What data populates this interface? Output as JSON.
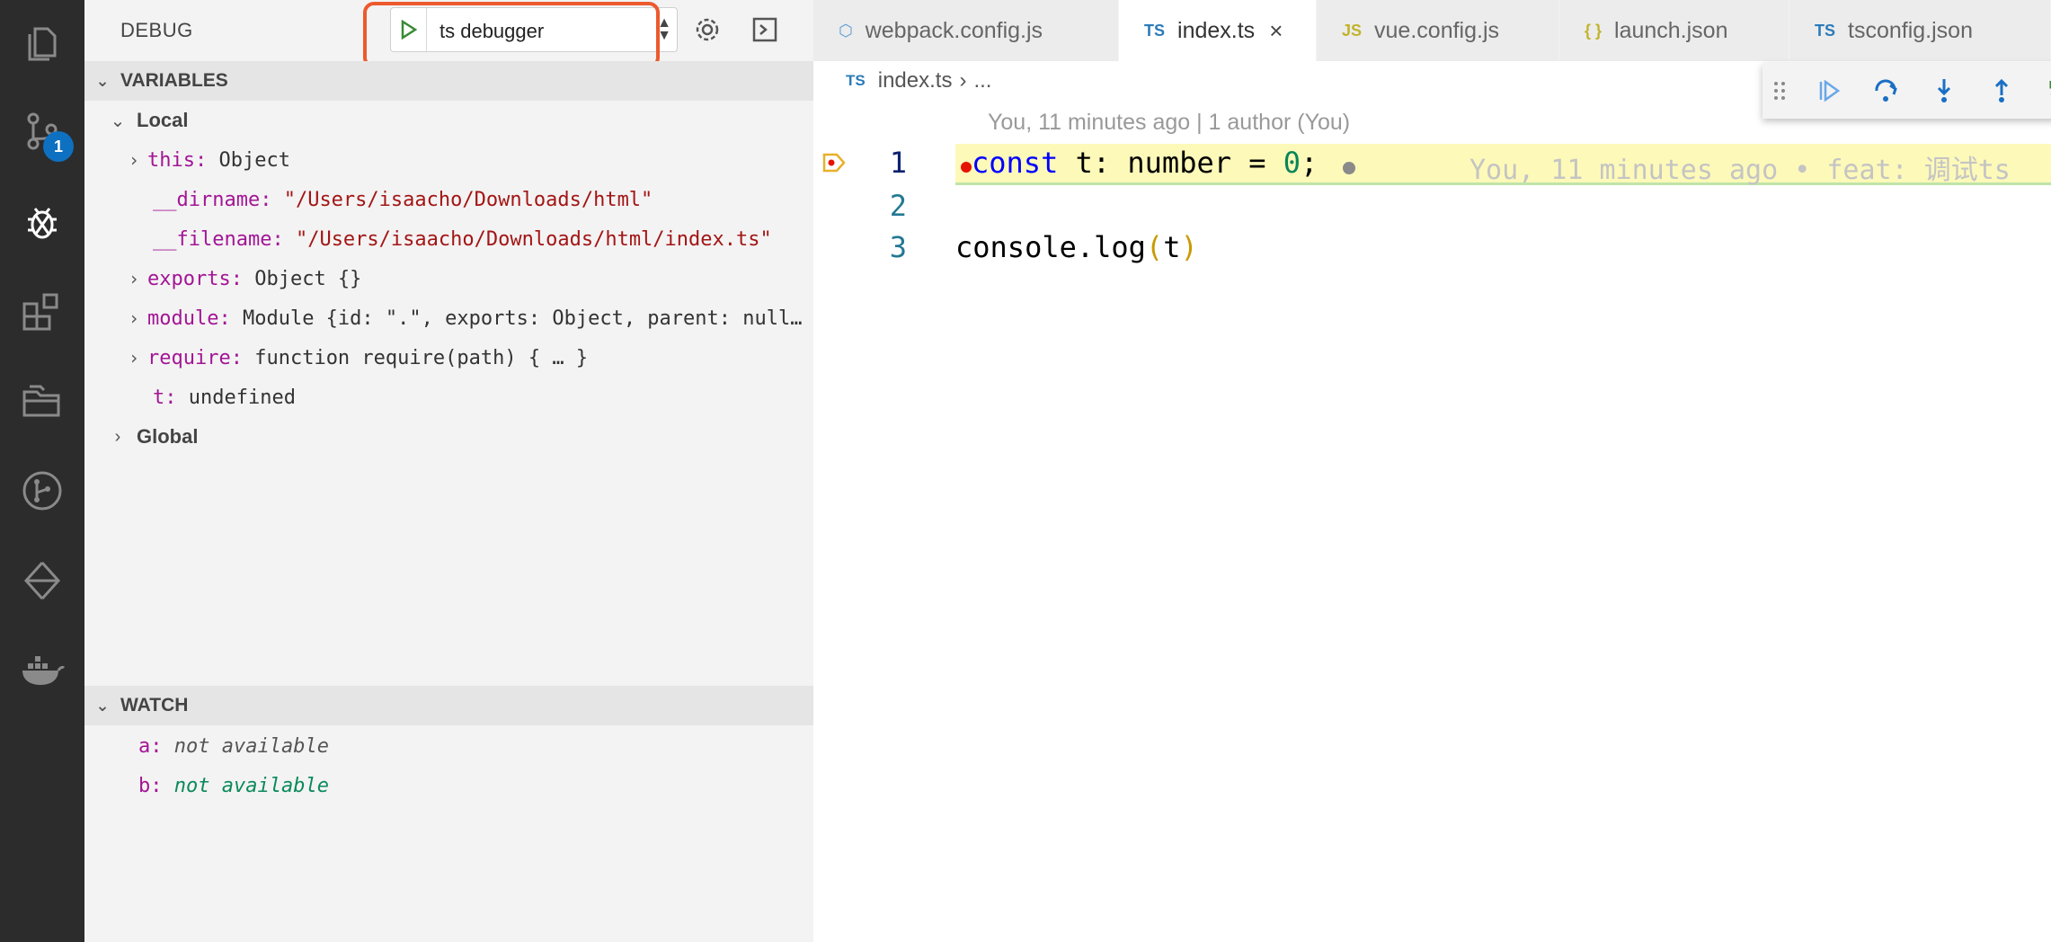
{
  "activity_bar": {
    "items": [
      {
        "name": "explorer-icon"
      },
      {
        "name": "source-control-icon",
        "badge": "1"
      },
      {
        "name": "debug-icon"
      },
      {
        "name": "extensions-icon"
      },
      {
        "name": "folders-icon"
      },
      {
        "name": "git-graph-icon"
      },
      {
        "name": "remote-icon"
      },
      {
        "name": "docker-icon"
      }
    ]
  },
  "sidebar": {
    "title": "DEBUG",
    "launch_config": "ts debugger",
    "variables_header": "VARIABLES",
    "local_scope": "Local",
    "global_scope": "Global",
    "variables": [
      {
        "name": "this:",
        "value": "Object"
      },
      {
        "name": "__dirname:",
        "value": "\"/Users/isaacho/Downloads/html\""
      },
      {
        "name": "__filename:",
        "value": "\"/Users/isaacho/Downloads/html/index.ts\""
      },
      {
        "name": "exports:",
        "value": "Object {}"
      },
      {
        "name": "module:",
        "value": "Module {id: \".\", exports: Object, parent: null…"
      },
      {
        "name": "require:",
        "value": "function require(path) { … }"
      },
      {
        "name": "t:",
        "value": "undefined"
      }
    ],
    "watch_header": "WATCH",
    "watch": [
      {
        "name": "a:",
        "value": "not available"
      },
      {
        "name": "b:",
        "value": "not available"
      }
    ]
  },
  "tabs": [
    {
      "icon": "⬡",
      "label": "webpack.config.js"
    },
    {
      "icon": "TS",
      "label": "index.ts",
      "close": "×"
    },
    {
      "icon": "JS",
      "label": "vue.config.js"
    },
    {
      "icon": "{ }",
      "label": "launch.json"
    },
    {
      "icon": "TS",
      "label": "tsconfig.json"
    }
  ],
  "breadcrumb": {
    "icon": "TS",
    "file": "index.ts",
    "sep": "›",
    "rest": "..."
  },
  "editor": {
    "blame": "You, 11 minutes ago | 1 author (You)",
    "line_numbers": [
      "1",
      "2",
      "3"
    ],
    "line1": {
      "kw": "const",
      "rest": " t: number = ",
      "num": "0",
      "end": ";",
      "blame": "You, 11 minutes ago • feat: 调试ts"
    },
    "line3": {
      "text": "console.log",
      "open": "(",
      "arg": "t",
      "close": ")"
    }
  },
  "colors": {
    "accent": "#0e70c0",
    "highlight": "#ec5a2e",
    "current_line": "#fdf9b9"
  }
}
